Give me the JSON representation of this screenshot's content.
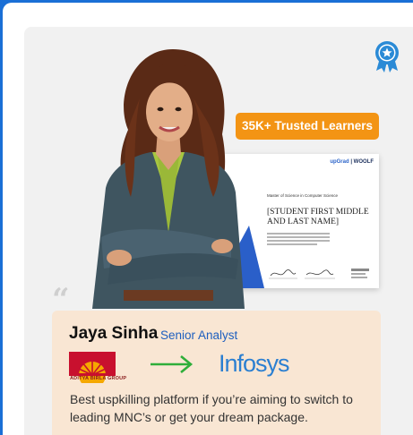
{
  "trusted_badge": {
    "label": "35K+ Trusted Learners"
  },
  "certificate": {
    "logo_brand_1": "upGrad",
    "logo_brand_2": "WOOLF",
    "degree": "Master of Science in Computer Science",
    "student_name": "[STUDENT FIRST MIDDLE AND LAST NAME]"
  },
  "testimonial": {
    "name": "Jaya Sinha",
    "role": "Senior Analyst",
    "from_company": "ADITYA BIRLA GROUP",
    "to_company": "Infosys",
    "quote": "Best uspkilling platform if you’re aiming to switch to leading MNC’s or get your dream package."
  },
  "colors": {
    "accent_orange": "#f39414",
    "role_blue": "#1e5fbf",
    "infosys_blue": "#2b7fd1",
    "arrow_green": "#2fae3a",
    "card_peach": "#f9e6d3"
  }
}
